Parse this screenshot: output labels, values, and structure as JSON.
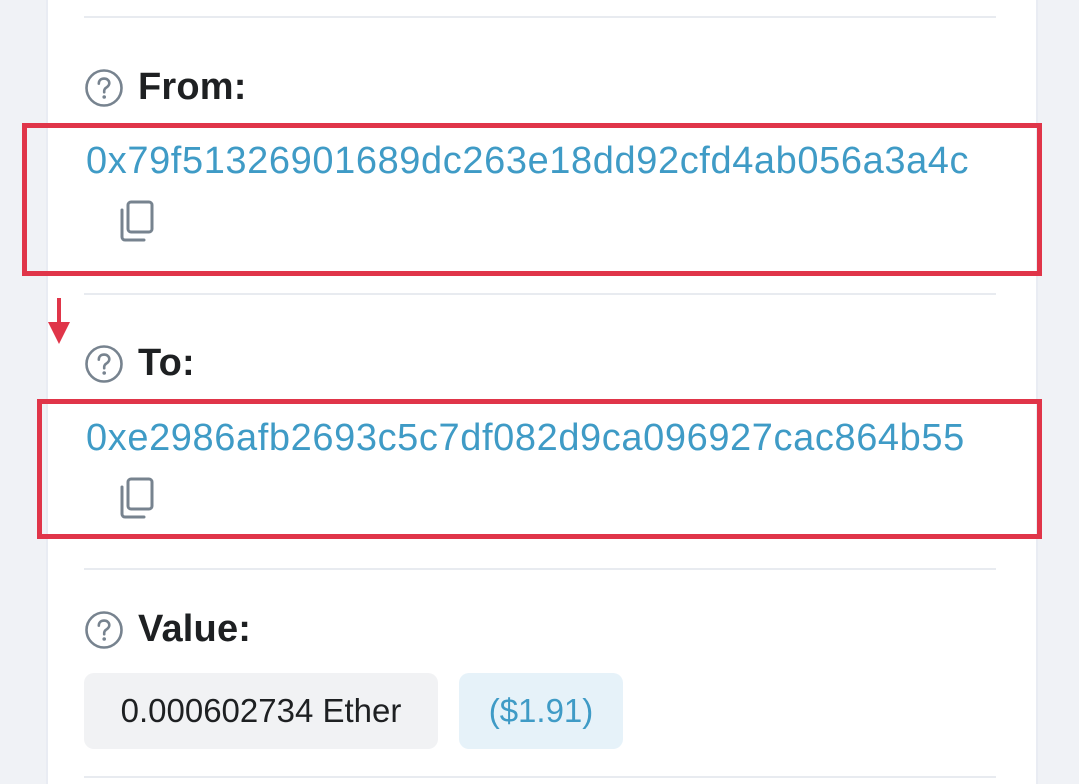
{
  "from": {
    "label": "From:",
    "address": "0x79f51326901689dc263e18dd92cfd4ab056a3a4c",
    "icon": "help-circle-icon",
    "copy_icon": "copy-icon"
  },
  "to": {
    "label": "To:",
    "address": "0xe2986afb2693c5c7df082d9ca096927cac864b55",
    "icon": "help-circle-icon",
    "copy_icon": "copy-icon"
  },
  "value": {
    "label": "Value:",
    "amount": "0.000602734 Ether",
    "usd": "($1.91)",
    "icon": "help-circle-icon"
  },
  "colors": {
    "link": "#3f9bc6",
    "highlight": "#e03549",
    "text": "#1e2022",
    "muted": "#77838f"
  }
}
